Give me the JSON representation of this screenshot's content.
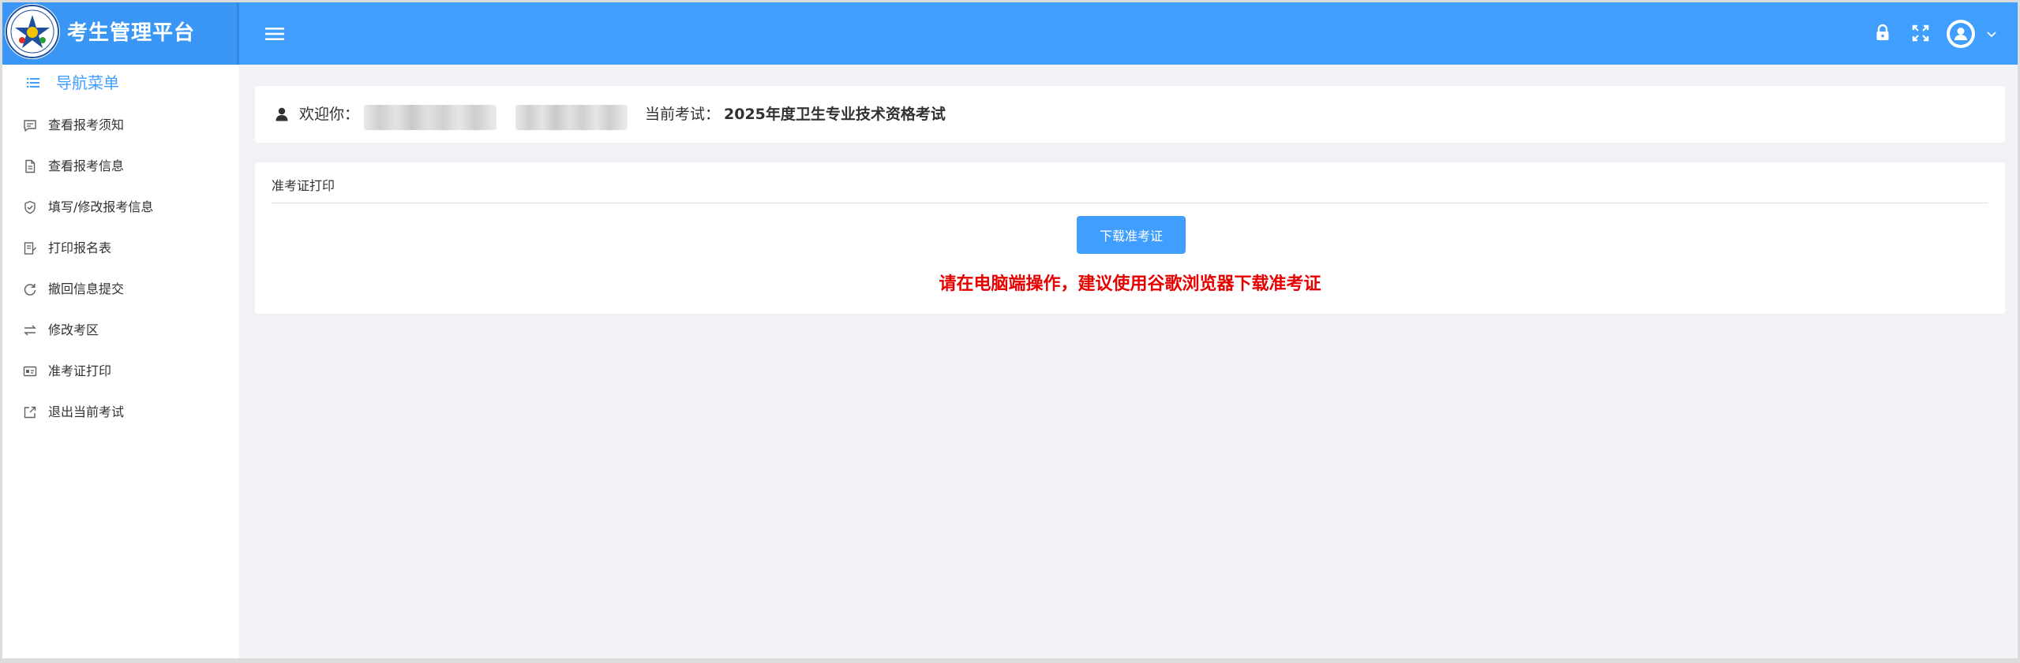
{
  "header": {
    "brand_title": "考生管理平台",
    "icons": [
      "menu-icon",
      "lock-icon",
      "fullscreen-icon",
      "avatar-icon",
      "chevron-down-icon"
    ]
  },
  "sidebar": {
    "nav_header": "导航菜单",
    "items": [
      {
        "label": "查看报考须知",
        "icon": "message-icon"
      },
      {
        "label": "查看报考信息",
        "icon": "document-icon"
      },
      {
        "label": "填写/修改报考信息",
        "icon": "shield-check-icon"
      },
      {
        "label": "打印报名表",
        "icon": "print-form-icon"
      },
      {
        "label": "撤回信息提交",
        "icon": "refresh-icon"
      },
      {
        "label": "修改考区",
        "icon": "switch-icon"
      },
      {
        "label": "准考证打印",
        "icon": "ticket-icon"
      },
      {
        "label": "退出当前考试",
        "icon": "exit-icon"
      }
    ]
  },
  "welcome": {
    "label": "欢迎你：",
    "exam_label": "当前考试：",
    "exam_name": "2025年度卫生专业技术资格考试"
  },
  "print_card": {
    "title": "准考证打印",
    "download_button": "下载准考证",
    "warning": "请在电脑端操作，建议使用谷歌浏览器下载准考证"
  },
  "colors": {
    "header_bg": "#409eff",
    "accent": "#409eff",
    "warning": "#e60000",
    "page_bg": "#f0f2f5"
  }
}
